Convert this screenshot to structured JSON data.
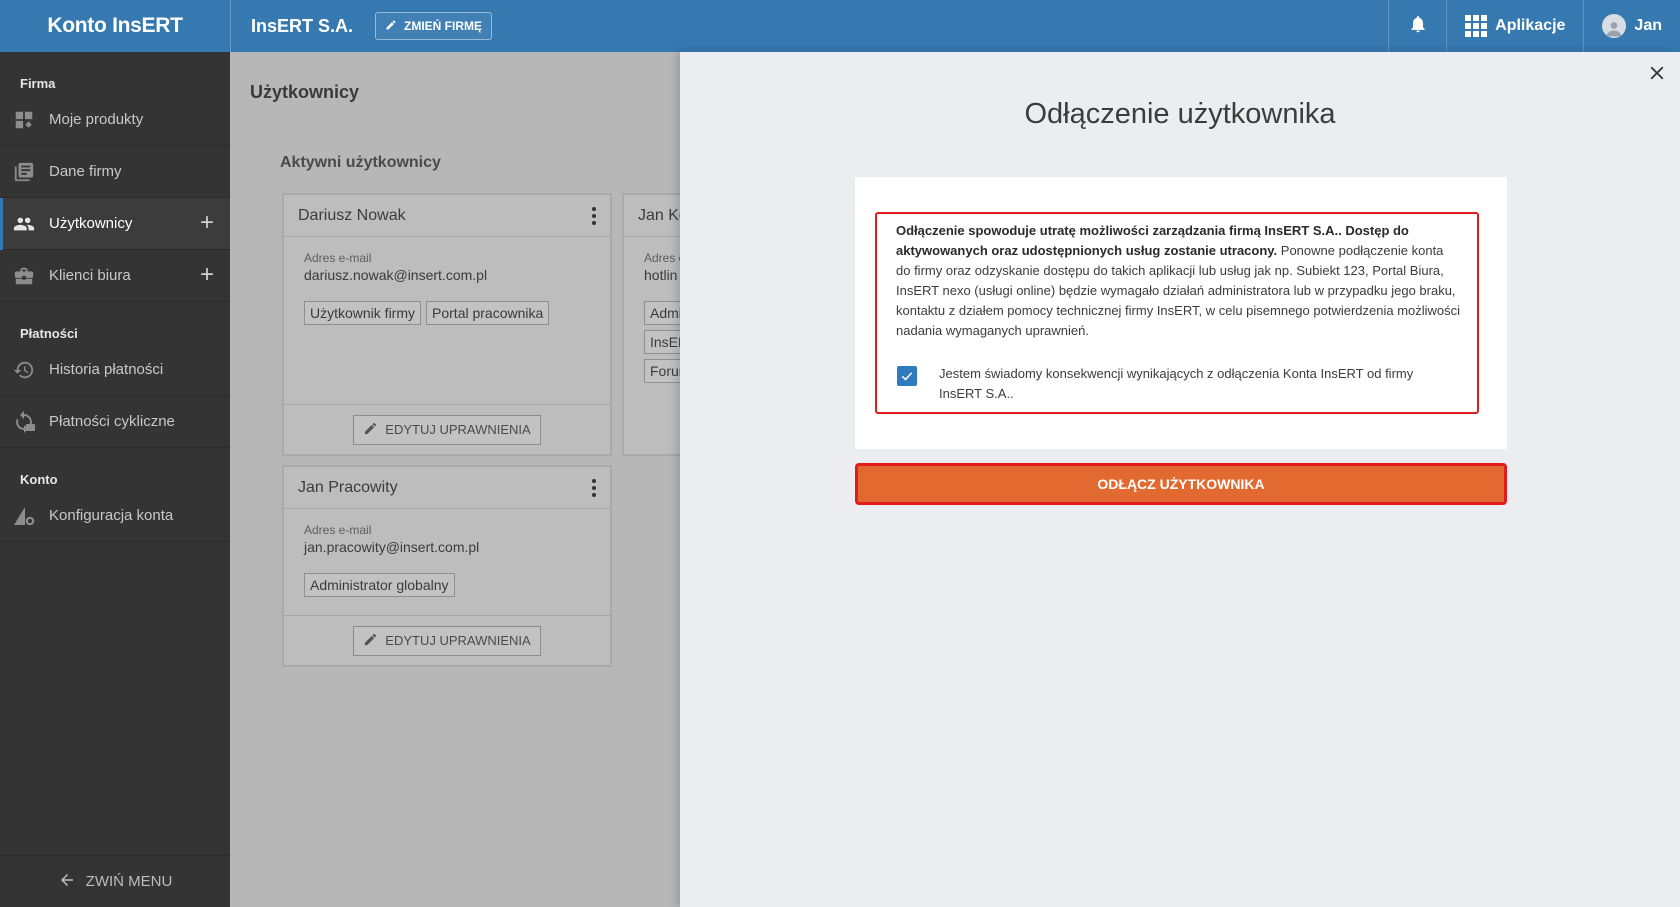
{
  "header": {
    "brand": "Konto InsERT",
    "company_name": "InsERT S.A.",
    "change_company_label": "ZMIEŃ FIRMĘ",
    "apps_label": "Aplikacje",
    "user_name": "Jan"
  },
  "sidebar": {
    "sections": [
      {
        "title": "Firma"
      },
      {
        "title": "Płatności"
      },
      {
        "title": "Konto"
      }
    ],
    "items": [
      {
        "label": "Moje produkty",
        "icon": "widgets-icon"
      },
      {
        "label": "Dane firmy",
        "icon": "document-icon"
      },
      {
        "label": "Użytkownicy",
        "icon": "users-icon",
        "active": true
      },
      {
        "label": "Klienci biura",
        "icon": "briefcase-icon"
      },
      {
        "label": "Historia płatności",
        "icon": "history-icon"
      },
      {
        "label": "Płatności cykliczne",
        "icon": "recurring-icon"
      },
      {
        "label": "Konfiguracja konta",
        "icon": "account-settings-icon"
      }
    ],
    "collapse_label": "ZWIŃ MENU"
  },
  "main": {
    "page_title": "Użytkownicy",
    "section_title": "Aktywni użytkownicy",
    "email_label": "Adres e-mail",
    "edit_label": "EDYTUJ UPRAWNIENIA",
    "cards": [
      {
        "name": "Dariusz Nowak",
        "email": "dariusz.nowak@insert.com.pl",
        "tags": [
          "Użytkownik firmy",
          "Portal pracownika"
        ]
      },
      {
        "name": "Jan Ko",
        "email_label": "Adres e",
        "email": "hotlin",
        "tags": [
          "Admi",
          "InsER",
          "Forur"
        ]
      },
      {
        "name": "Jan Pracowity",
        "email": "jan.pracowity@insert.com.pl",
        "tags": [
          "Administrator globalny"
        ]
      }
    ]
  },
  "panel": {
    "title": "Odłączenie użytkownika",
    "warning_bold": "Odłączenie spowoduje utratę możliwości zarządzania firmą InsERT S.A.. Dostęp do aktywowanych oraz udostępnionych usług zostanie utracony.",
    "warning_rest": " Ponowne podłączenie konta do firmy oraz odzyskanie dostępu do takich aplikacji lub usług jak np. Subiekt 123, Portal Biura, InsERT nexo (usługi online) będzie wymagało działań administratora lub w przypadku jego braku, kontaktu z działem pomocy technicznej firmy InsERT, w celu pisemnego potwierdzenia możliwości nadania wymaganych uprawnień.",
    "checkbox_label": "Jestem świadomy konsekwencji wynikających z odłączenia Konta InsERT od firmy InsERT S.A..",
    "checkbox_checked": true,
    "disconnect_label": "ODŁĄCZ UŻYTKOWNIKA"
  },
  "colors": {
    "topbar": "#3579b0",
    "sidebar": "#343434",
    "accent_orange": "#e2692f",
    "highlight_red": "#e01c1c",
    "checkbox_blue": "#2f7bbf"
  }
}
